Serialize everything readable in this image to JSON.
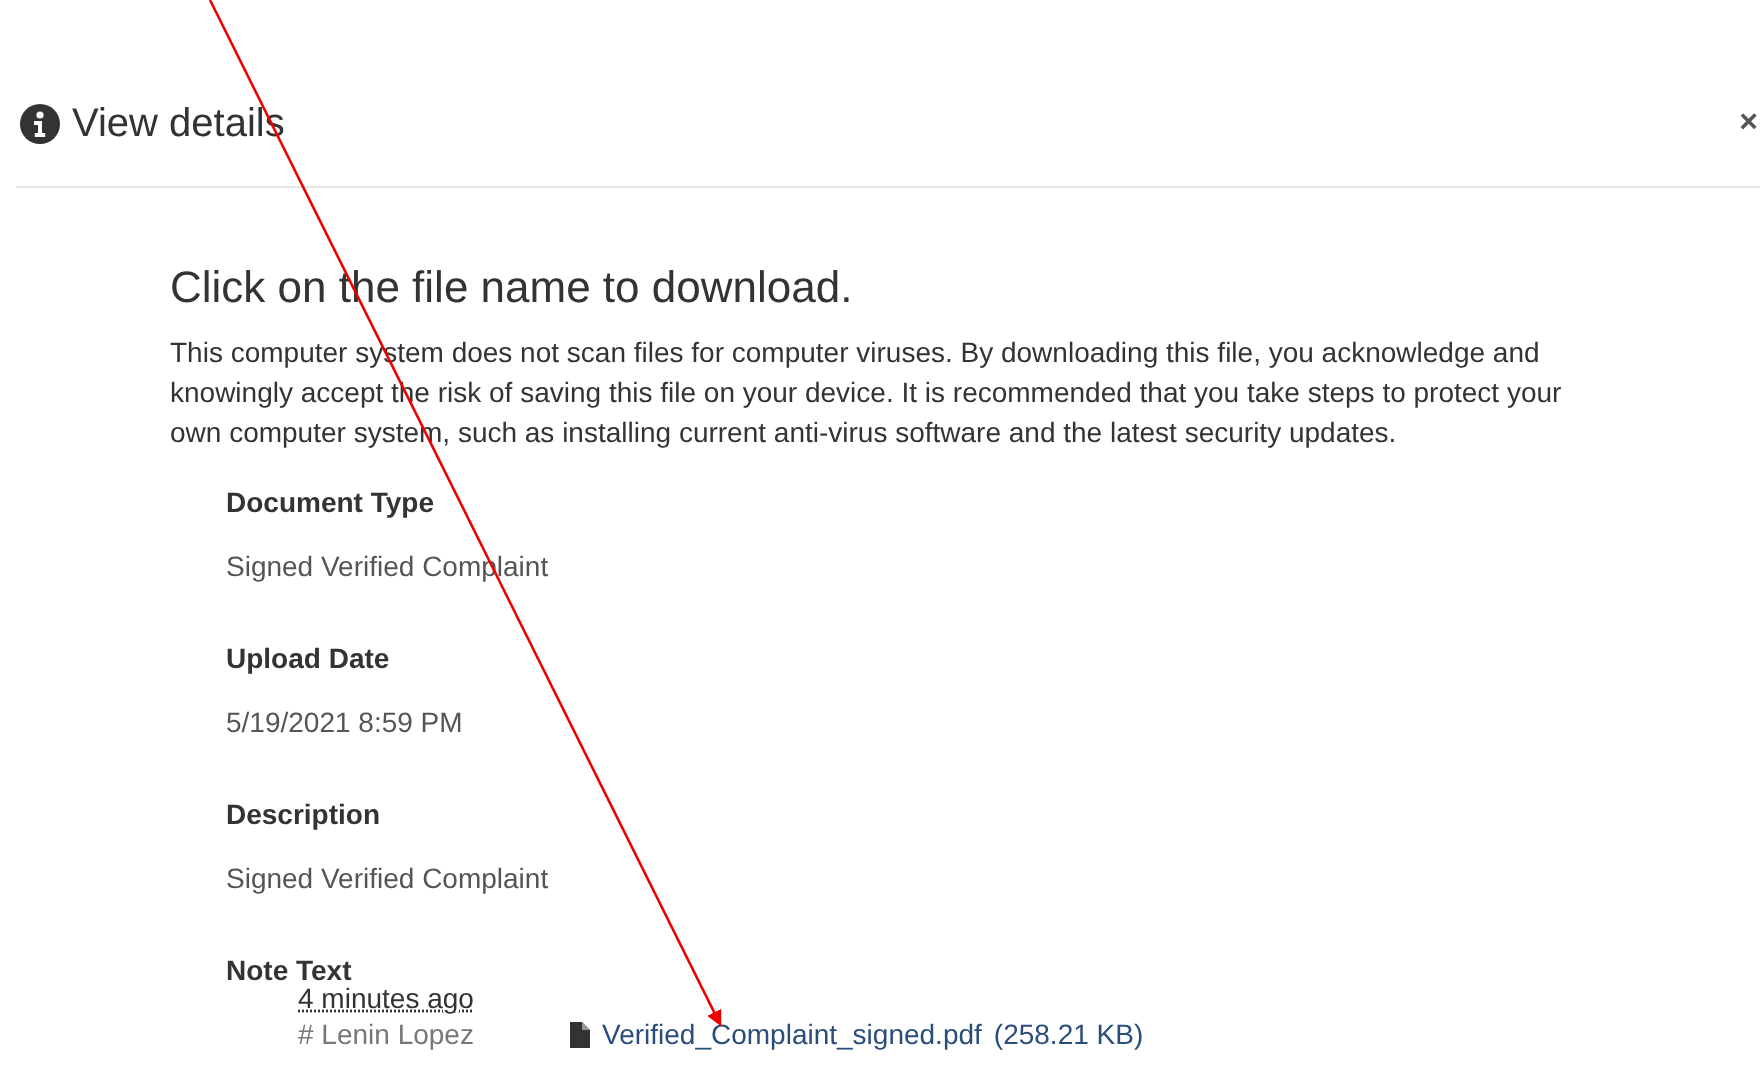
{
  "header": {
    "title": "View details",
    "close": "×"
  },
  "heading": "Click on the file name to download.",
  "notice": "This computer system does not scan files for computer viruses. By downloading this file, you acknowledge and knowingly accept the risk of saving this file on your device. It is recommended that you take steps to protect your own computer system, such as installing current anti-virus software and the latest security updates.",
  "fields": [
    {
      "label": "Document Type",
      "value": "Signed Verified Complaint"
    },
    {
      "label": "Upload Date",
      "value": "5/19/2021 8:59 PM"
    },
    {
      "label": "Description",
      "value": "Signed Verified Complaint"
    }
  ],
  "note": {
    "label": "Note Text",
    "time": "4 minutes ago",
    "author": "# Lenin Lopez",
    "file": "Verified_Complaint_signed.pdf",
    "size": "(258.21 KB)"
  }
}
